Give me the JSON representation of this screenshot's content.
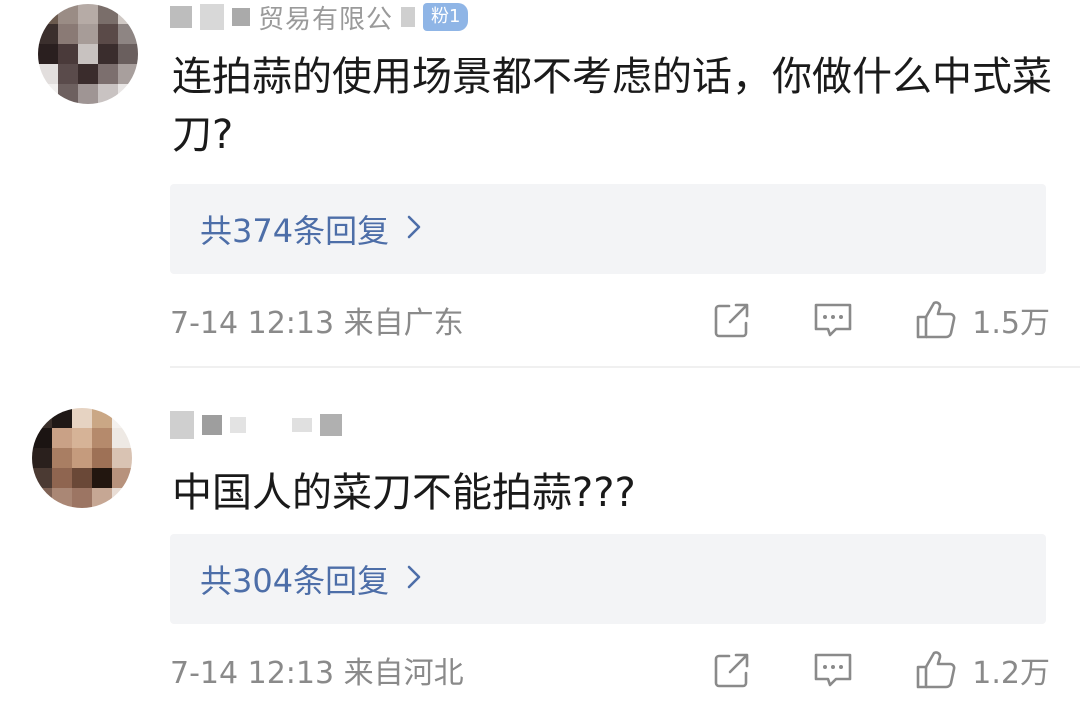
{
  "comments": [
    {
      "name_fragment": "贸易有限公",
      "badge": "粉1",
      "text": "连拍蒜的使用场景都不考虑的话，你做什么中式菜刀?",
      "replies": "共374条回复",
      "time_location": "7-14 12:13 来自广东",
      "likes": "1.5万"
    },
    {
      "text": "中国人的菜刀不能拍蒜???",
      "replies": "共304条回复",
      "time_location": "7-14 12:13 来自河北",
      "likes": "1.2万"
    }
  ],
  "icons": {
    "share": "share-icon",
    "comment": "comment-icon",
    "like": "thumbs-up-icon",
    "chevron": "chevron-right-icon"
  },
  "colors": {
    "link": "#4d6ea8",
    "meta": "#8a8a8a",
    "reply_bg": "#f3f4f6"
  }
}
